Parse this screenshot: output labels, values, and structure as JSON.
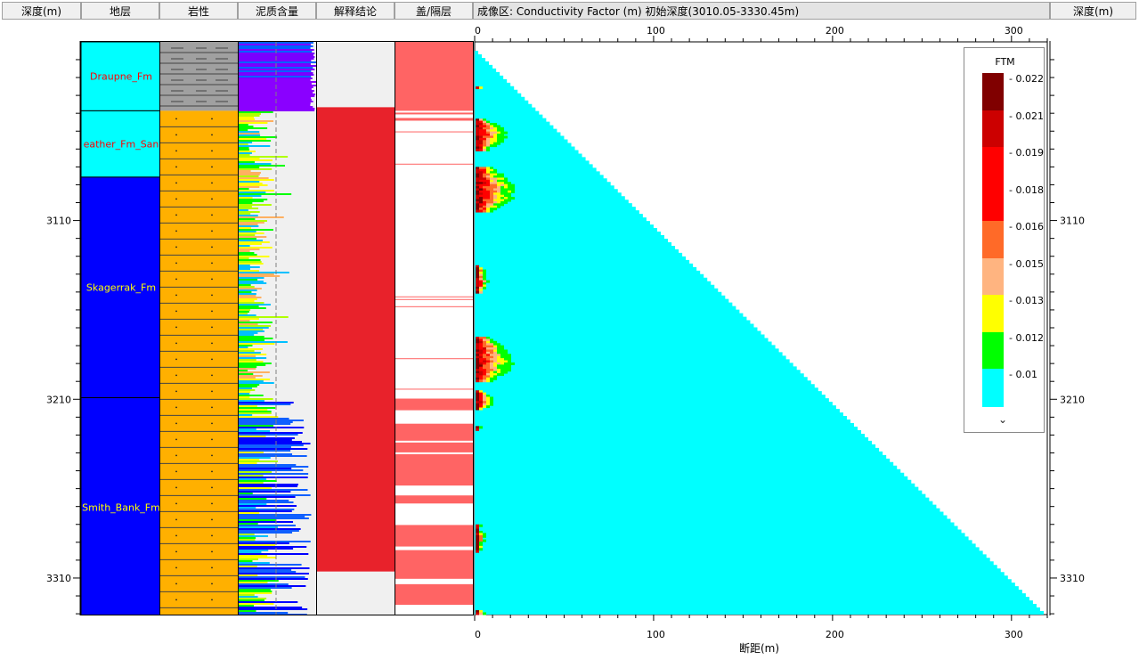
{
  "header": {
    "depth_left": "深度(m)",
    "formation": "地层",
    "lithology": "岩性",
    "shale": "泥质含量",
    "interpretation": "解释结论",
    "seal": "盖/隔层",
    "image_title": "成像区: Conductivity Factor (m)  初始深度(3010.05-3330.45m)",
    "depth_right": "深度(m)"
  },
  "depth_axis": {
    "labels": [
      "3110",
      "3210",
      "3310"
    ],
    "values": [
      3110,
      3210,
      3310
    ],
    "top": 3010.05,
    "bottom": 3330.45
  },
  "formations": [
    {
      "name": "Draupne_Fm",
      "top": 3010.05,
      "bottom": 3048.5,
      "color": "#00ffff",
      "label_color": "#ff0000"
    },
    {
      "name": "eather_Fm_San",
      "top": 3048.5,
      "bottom": 3085.5,
      "color": "#00ffff",
      "label_color": "#ff0000"
    },
    {
      "name": "Skagerrak_Fm",
      "top": 3085.5,
      "bottom": 3208.5,
      "color": "#0000ff",
      "label_color": "#ffff00"
    },
    {
      "name": "Smith_Bank_Fm",
      "top": 3208.5,
      "bottom": 3330.45,
      "color": "#0000ff",
      "label_color": "#ffff00"
    }
  ],
  "lithology": [
    {
      "type": "shale",
      "top": 3010.05,
      "bottom": 3048.5,
      "color": "#a0a0a0"
    },
    {
      "type": "sandstone",
      "top": 3048.5,
      "bottom": 3330.45,
      "color": "#ffb000"
    }
  ],
  "interpretation": [
    {
      "top": 3010.05,
      "bottom": 3046.5,
      "color": "#f0f0f0"
    },
    {
      "top": 3046.5,
      "bottom": 3305.5,
      "color": "#e8222b"
    },
    {
      "top": 3305.5,
      "bottom": 3330.45,
      "color": "#f0f0f0"
    }
  ],
  "seal_color": "#ff6464",
  "seal_intervals": [
    [
      3010.05,
      3048.5
    ],
    [
      3049.5,
      3050.5
    ],
    [
      3052.5,
      3054.0
    ],
    [
      3060.0,
      3060.4
    ],
    [
      3078.0,
      3078.4
    ],
    [
      3152.0,
      3152.4
    ],
    [
      3153.5,
      3153.9
    ],
    [
      3157.5,
      3157.8
    ],
    [
      3186.5,
      3186.8
    ],
    [
      3203.5,
      3203.8
    ],
    [
      3209.0,
      3215.5
    ],
    [
      3223.0,
      3232.5
    ],
    [
      3233.5,
      3239.0
    ],
    [
      3240.0,
      3257.5
    ],
    [
      3263.0,
      3267.5
    ],
    [
      3279.5,
      3291.5
    ],
    [
      3293.5,
      3309.5
    ],
    [
      3312.5,
      3324.0
    ]
  ],
  "image_track": {
    "xaxis_title": "断距(m)",
    "ticks": [
      "0",
      "100",
      "200",
      "300"
    ],
    "tick_values": [
      0,
      100,
      200,
      300
    ],
    "xmax": 320,
    "background_color": "#00ffff"
  },
  "legend": {
    "title": "FTM",
    "items": [
      {
        "value": "0.022",
        "color": "#800000"
      },
      {
        "value": "0.021",
        "color": "#cc0000"
      },
      {
        "value": "0.019",
        "color": "#ff0000"
      },
      {
        "value": "0.018",
        "color": "#ff0000"
      },
      {
        "value": "0.016",
        "color": "#ff6a28"
      },
      {
        "value": "0.015",
        "color": "#ffb480"
      },
      {
        "value": "0.013",
        "color": "#ffff00"
      },
      {
        "value": "0.012",
        "color": "#00ff00"
      },
      {
        "value": "0.01",
        "color": "#00ffff"
      }
    ],
    "chevron": "⌄"
  },
  "colors": {
    "shale_track_bg": "#f0f0f0",
    "cutoff_line": "#808080"
  }
}
